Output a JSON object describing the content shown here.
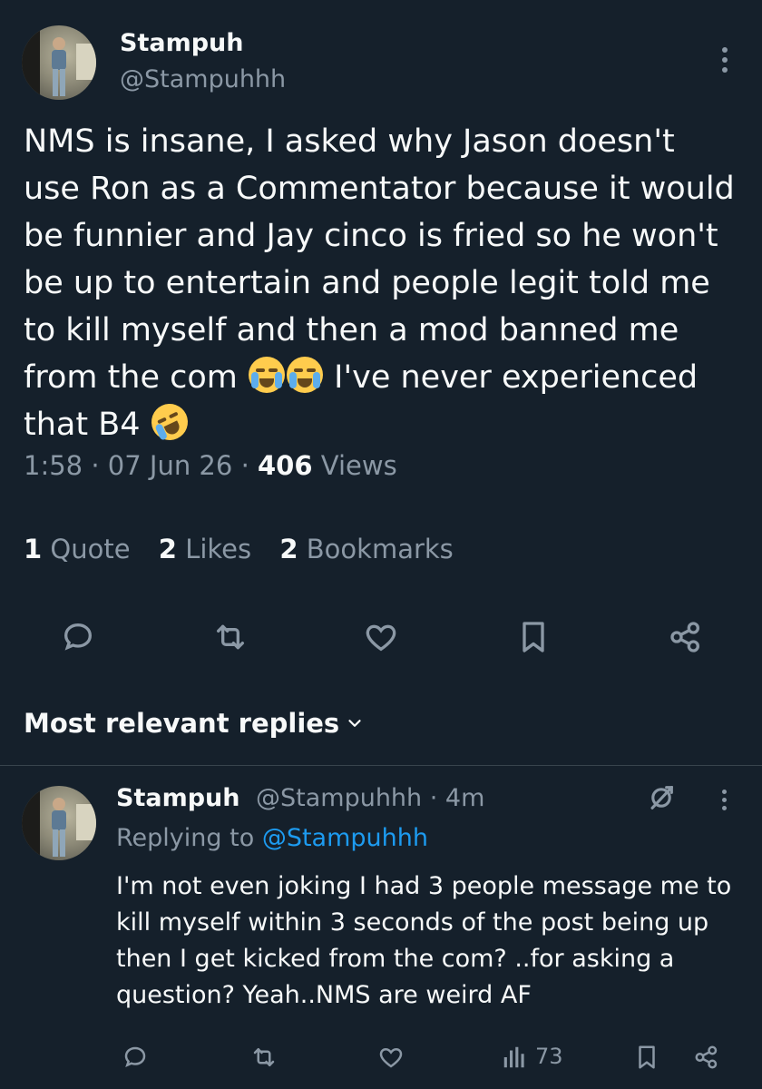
{
  "tweet": {
    "author_name": "Stampuh",
    "author_handle": "@Stampuhhh",
    "text_parts": [
      "NMS is insane, I asked why Jason doesn't use Ron as a Commentator because it would be funnier and Jay cinco is fried so he won't be up to entertain and people legit told me to kill myself and then a mod banned me from the com ",
      " I've never experienced that B4 "
    ],
    "time": "1:58",
    "date": "07 Jun 26",
    "views_count": "406",
    "views_label": "Views",
    "separator": "·",
    "stats": {
      "quotes_count": "1",
      "quotes_label": "Quote",
      "likes_count": "2",
      "likes_label": "Likes",
      "bookmarks_count": "2",
      "bookmarks_label": "Bookmarks"
    }
  },
  "icons": [
    "reply-icon",
    "retweet-icon",
    "like-icon",
    "bookmark-icon",
    "share-icon",
    "more-icon",
    "chevron-down-icon",
    "edited-icon",
    "views-icon"
  ],
  "replies_section": {
    "title": "Most relevant replies"
  },
  "reply": {
    "author_name": "Stampuh",
    "author_handle": "@Stampuhhh",
    "time_ago": "· 4m",
    "replying_label": "Replying to",
    "replying_to": "@Stampuhhh",
    "text": "I'm not even joking I had 3 people message me to kill myself within 3 seconds of the post being up then I get kicked from the com? ..for asking a question? Yeah..NMS are weird AF",
    "views": "73"
  },
  "colors": {
    "background": "#15202b",
    "text": "#f7f9f9",
    "muted": "#8b98a5",
    "link": "#1d9bf0",
    "divider": "#38444d"
  }
}
